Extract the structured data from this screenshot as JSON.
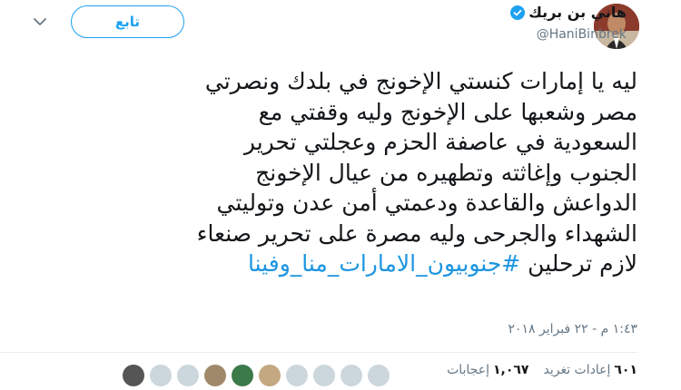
{
  "header": {
    "display_name": "هاني بن بريك",
    "handle": "@HaniBinbrek",
    "follow_label": "تابع"
  },
  "tweet": {
    "text": "ليه يا إمارات كنستي الإخونج في بلدك ونصرتي\nمصر وشعبها على الإخونج وليه وقفتي مع\nالسعودية في عاصفة الحزم وعجلتي تحرير\nالجنوب وإغاثته وتطهيره من عيال الإخونج\nالدواعش والقاعدة ودعمتي أمن عدن وتوليتي\nالشهداء والجرحى وليه مصرة على تحرير صنعاء\nلازم ترحلين ",
    "hashtag": "#جنوبيون_الامارات_منا_وفينا",
    "timestamp": "١:٤٣ م - ٢٢ فبراير ٢٠١٨"
  },
  "stats": {
    "retweets_count": "٦٠١",
    "retweets_label": "إعادات تغريد",
    "likes_count": "١,٠٦٧",
    "likes_label": "إعجابات"
  },
  "colors": {
    "accent": "#1da1f2",
    "hashtag": "#1b95e0",
    "muted": "#657786"
  }
}
